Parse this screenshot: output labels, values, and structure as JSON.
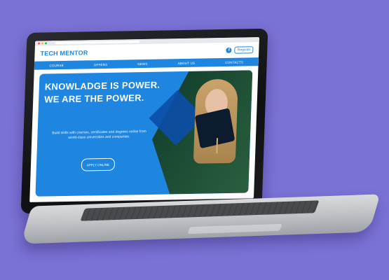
{
  "site": {
    "brand": "TECH MENTOR",
    "header": {
      "register_label": "Register",
      "facebook_icon": "facebook-icon"
    },
    "nav": [
      "COURSE",
      "OFFERS",
      "NEWS",
      "ABOUT US",
      "CONTACTS"
    ],
    "hero": {
      "headline_line1": "KNOWLADGE IS POWER.",
      "headline_line2": "WE ARE THE POWER.",
      "subtext": "Build skills with courses, certificates and degrees online from world-class universities and companies.",
      "apply_label": "APPLY ONLINE"
    }
  },
  "colors": {
    "background": "#7b72d6",
    "accent": "#1e86e0",
    "nav": "#1e86e0"
  }
}
